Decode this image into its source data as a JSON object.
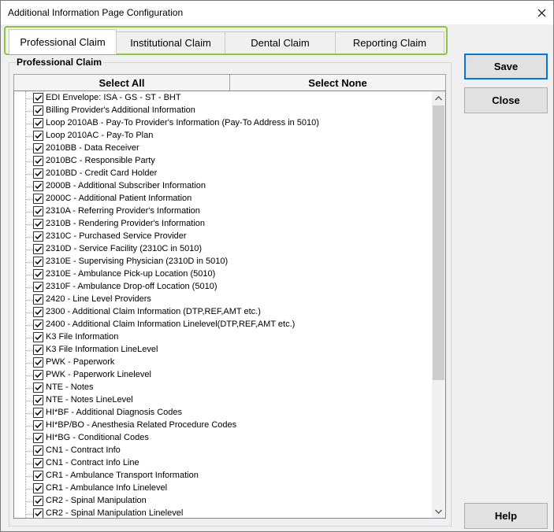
{
  "window": {
    "title": "Additional Information Page Configuration"
  },
  "tabs": [
    {
      "label": "Professional Claim",
      "active": true
    },
    {
      "label": "Institutional Claim",
      "active": false
    },
    {
      "label": "Dental Claim",
      "active": false
    },
    {
      "label": "Reporting Claim",
      "active": false
    }
  ],
  "group": {
    "title": "Professional Claim"
  },
  "header": {
    "select_all": "Select All",
    "select_none": "Select None"
  },
  "items": [
    {
      "label": "EDI Envelope: ISA - GS - ST - BHT",
      "checked": true
    },
    {
      "label": "Billing Provider's Additional Information",
      "checked": true
    },
    {
      "label": "Loop 2010AB - Pay-To Provider's Information (Pay-To Address in 5010)",
      "checked": true
    },
    {
      "label": "Loop 2010AC - Pay-To Plan",
      "checked": true
    },
    {
      "label": "2010BB - Data Receiver",
      "checked": true
    },
    {
      "label": "2010BC - Responsible Party",
      "checked": true
    },
    {
      "label": "2010BD - Credit Card Holder",
      "checked": true
    },
    {
      "label": "2000B - Additional Subscriber Information",
      "checked": true
    },
    {
      "label": "2000C - Additional Patient Information",
      "checked": true
    },
    {
      "label": "2310A - Referring Provider's Information",
      "checked": true
    },
    {
      "label": "2310B - Rendering Provider's Information",
      "checked": true
    },
    {
      "label": "2310C - Purchased Service Provider",
      "checked": true
    },
    {
      "label": "2310D - Service Facility (2310C in 5010)",
      "checked": true
    },
    {
      "label": "2310E - Supervising Physician (2310D in 5010)",
      "checked": true
    },
    {
      "label": "2310E - Ambulance Pick-up Location (5010)",
      "checked": true
    },
    {
      "label": "2310F - Ambulance Drop-off Location (5010)",
      "checked": true
    },
    {
      "label": "2420 - Line Level Providers",
      "checked": true
    },
    {
      "label": "2300 - Additional Claim Information (DTP,REF,AMT etc.)",
      "checked": true
    },
    {
      "label": "2400 - Additional Claim Information Linelevel(DTP,REF,AMT etc.)",
      "checked": true
    },
    {
      "label": "K3 File Information",
      "checked": true
    },
    {
      "label": "K3 File Information LineLevel",
      "checked": true
    },
    {
      "label": "PWK - Paperwork",
      "checked": true
    },
    {
      "label": "PWK - Paperwork Linelevel",
      "checked": true
    },
    {
      "label": "NTE - Notes",
      "checked": true
    },
    {
      "label": "NTE - Notes LineLevel",
      "checked": true
    },
    {
      "label": "HI*BF - Additional Diagnosis Codes",
      "checked": true
    },
    {
      "label": "HI*BP/BO - Anesthesia Related Procedure Codes",
      "checked": true
    },
    {
      "label": "HI*BG - Conditional Codes",
      "checked": true
    },
    {
      "label": "CN1 - Contract Info",
      "checked": true
    },
    {
      "label": "CN1 - Contract Info Line",
      "checked": true
    },
    {
      "label": "CR1 - Ambulance Transport Information",
      "checked": true
    },
    {
      "label": "CR1 - Ambulance Info Linelevel",
      "checked": true
    },
    {
      "label": "CR2 - Spinal Manipulation",
      "checked": true
    },
    {
      "label": "CR2 - Spinal Manipulation Linelevel",
      "checked": true
    }
  ],
  "buttons": {
    "save": "Save",
    "close": "Close",
    "help": "Help"
  },
  "colors": {
    "tab_highlight": "#8cc63f",
    "default_button_border": "#0078d7"
  }
}
